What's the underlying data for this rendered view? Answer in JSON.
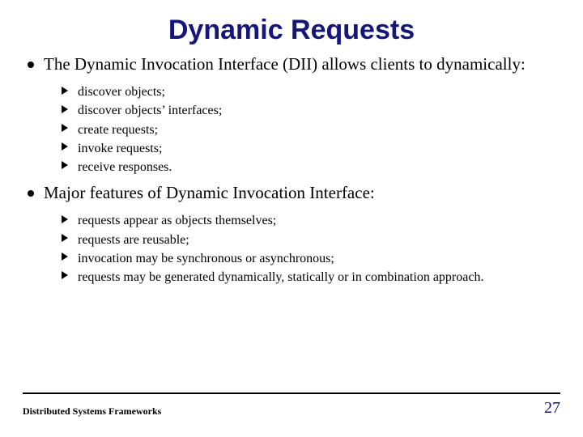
{
  "title": "Dynamic Requests",
  "body": {
    "items": [
      {
        "text": "The Dynamic Invocation Interface (DII) allows clients to dynamically:",
        "sub": [
          "discover objects;",
          "discover objects’ interfaces;",
          "create requests;",
          "invoke requests;",
          "receive responses."
        ]
      },
      {
        "text": "Major features of Dynamic Invocation Interface:",
        "sub": [
          "requests appear as objects themselves;",
          "requests are reusable;",
          "invocation may be synchronous or asynchronous;",
          "requests may be generated dynamically, statically or in combination approach."
        ]
      }
    ]
  },
  "footer": {
    "left": "Distributed Systems Frameworks",
    "page": "27"
  }
}
